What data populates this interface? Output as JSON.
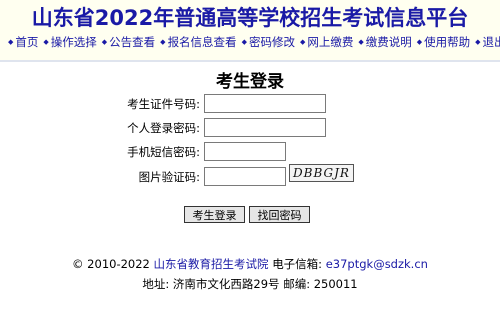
{
  "header": {
    "title": "山东省2022年普通高等学校招生考试信息平台"
  },
  "nav": {
    "items": [
      {
        "label": "首页"
      },
      {
        "label": "操作选择"
      },
      {
        "label": "公告查看"
      },
      {
        "label": "报名信息查看"
      },
      {
        "label": "密码修改"
      },
      {
        "label": "网上缴费"
      },
      {
        "label": "缴费说明"
      },
      {
        "label": "使用帮助"
      },
      {
        "label": "退出"
      }
    ]
  },
  "login": {
    "title": "考生登录",
    "fields": {
      "exam_id": {
        "label": "考生证件号码:",
        "value": ""
      },
      "password": {
        "label": "个人登录密码:",
        "value": ""
      },
      "sms_code": {
        "label": "手机短信密码:",
        "value": ""
      },
      "captcha": {
        "label": "图片验证码:",
        "value": ""
      }
    },
    "captcha_text": "DBBGJR",
    "login_button": "考生登录",
    "recover_button": "找回密码"
  },
  "footer": {
    "copyright": "© 2010-2022",
    "org": "山东省教育招生考试院",
    "email_label": "电子信箱:",
    "email": "e37ptgk@sdzk.cn",
    "address": "地址: 济南市文化西路29号 邮编: 250011"
  },
  "colors": {
    "link_blue": "#1a1aa6",
    "header_bg": "#fffff0"
  }
}
